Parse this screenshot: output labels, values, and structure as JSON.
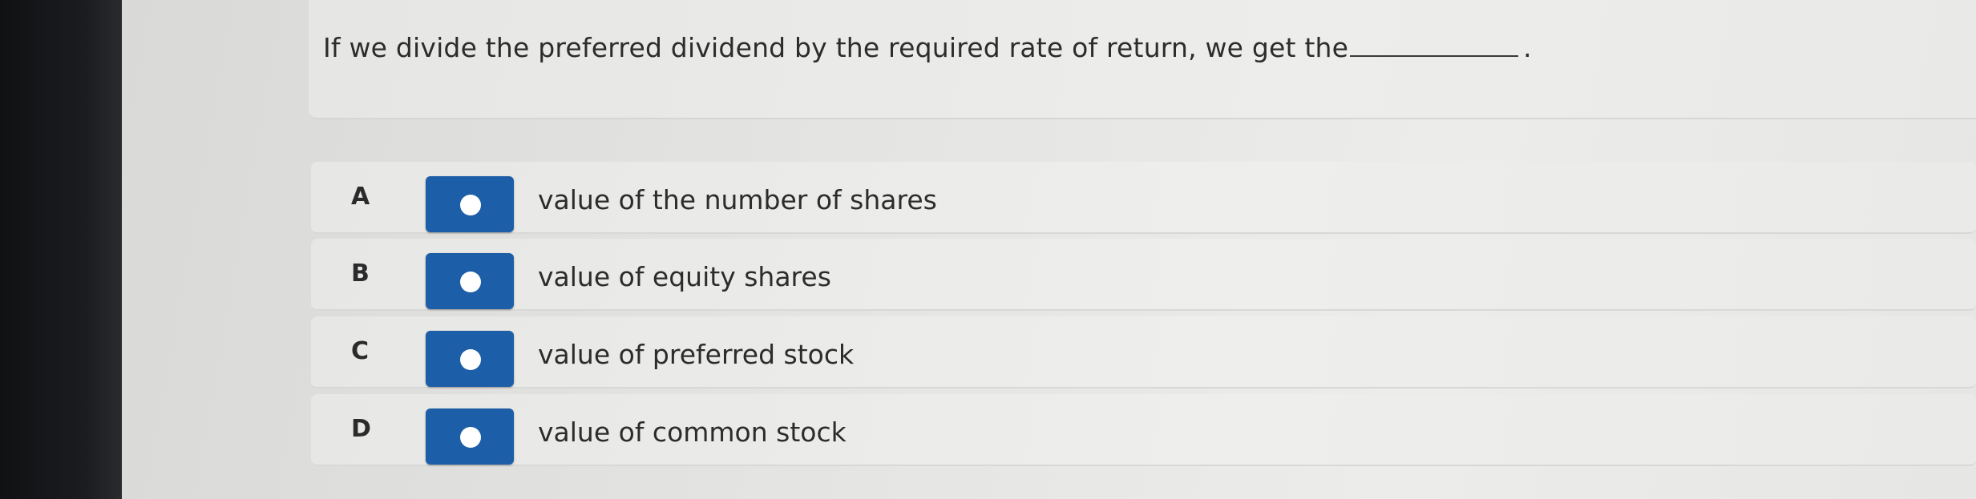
{
  "question": {
    "text": "If we divide the preferred dividend by the required rate of return, we get the",
    "end_punct": "."
  },
  "options": [
    {
      "letter": "A",
      "text": "value of the number of shares"
    },
    {
      "letter": "B",
      "text": "value of equity shares"
    },
    {
      "letter": "C",
      "text": "value of preferred stock"
    },
    {
      "letter": "D",
      "text": "value of common stock"
    }
  ],
  "colors": {
    "radio_box": "#1d5ea8",
    "radio_dot": "#ffffff"
  },
  "icons": {
    "radio": "radio-button-icon"
  }
}
